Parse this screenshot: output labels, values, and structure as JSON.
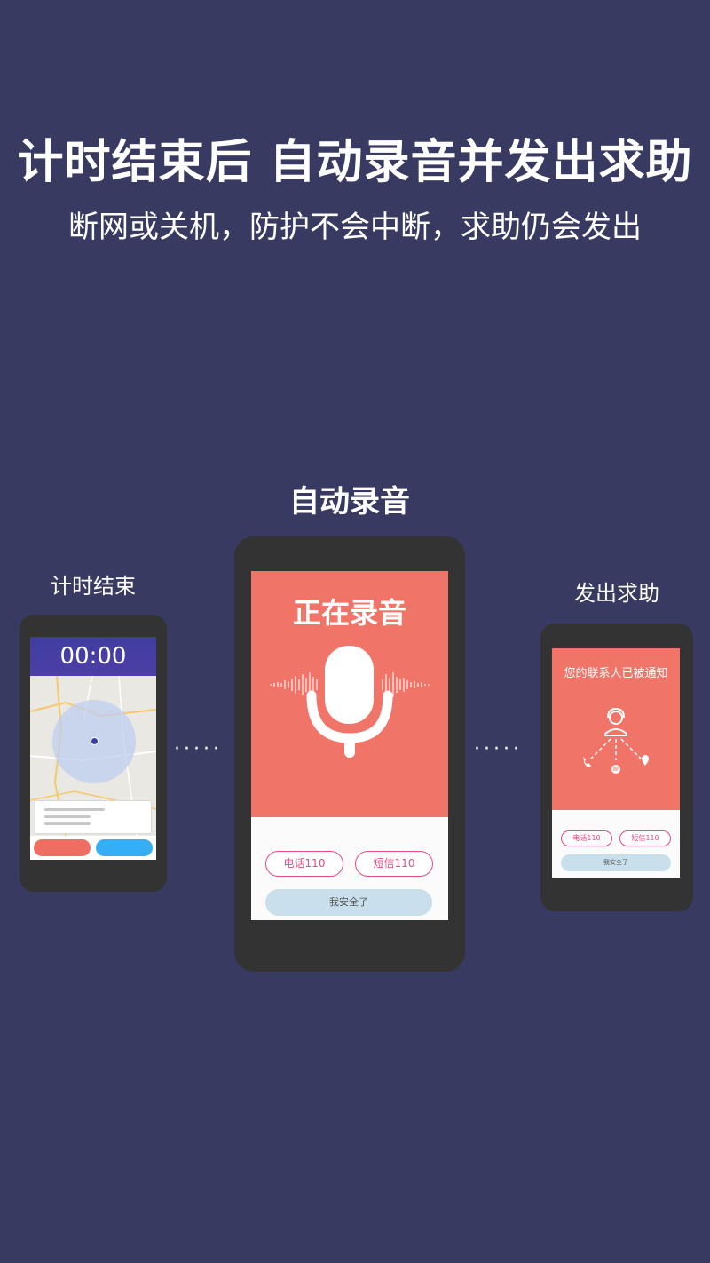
{
  "header": {
    "headline": "计时结束后  自动录音并发出求助",
    "subline": "断网或关机，防护不会中断，求助仍会发出"
  },
  "steps": {
    "left_label": "计时结束",
    "middle_label": "自动录音",
    "right_label": "发出求助"
  },
  "left_phone": {
    "timer": "00:00"
  },
  "middle_phone": {
    "recording_title": "正在录音",
    "call_button": "电话110",
    "sms_button": "短信110",
    "safe_button": "我安全了"
  },
  "right_phone": {
    "notice": "您的联系人已被通知",
    "call_button": "电话110",
    "sms_button": "短信110",
    "safe_button": "我安全了"
  },
  "connectors": {
    "dots": "·····"
  },
  "colors": {
    "background": "#393a61",
    "phone_body": "#333333",
    "coral": "#f07468",
    "timer_bar": "#3f3da0",
    "pink_outline": "#e94b83",
    "safe_button": "#c9e0ec",
    "blue_button": "#35aef6"
  },
  "icons": [
    "microphone-icon",
    "headset-agent-icon",
    "phone-icon",
    "message-icon",
    "location-pin-icon",
    "map-location-dot-icon"
  ]
}
